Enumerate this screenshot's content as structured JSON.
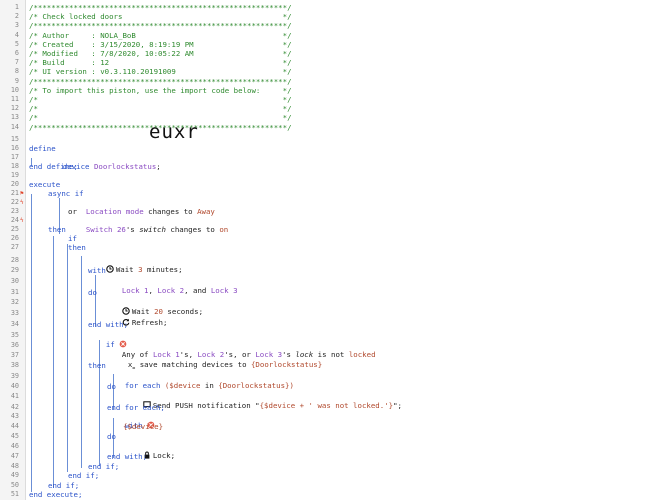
{
  "lines": [
    {
      "n": "1",
      "t": "/*********************************************************/"
    },
    {
      "n": "2",
      "t": "/* Check locked doors                                    */"
    },
    {
      "n": "3",
      "t": "/*********************************************************/"
    },
    {
      "n": "4",
      "t": "/* Author     : NOLA_BoB                                 */"
    },
    {
      "n": "5",
      "t": "/* Created    : 3/15/2020, 8:19:19 PM                    */"
    },
    {
      "n": "6",
      "t": "/* Modified   : 7/8/2020, 10:05:22 AM                    */"
    },
    {
      "n": "7",
      "t": "/* Build      : 12                                       */"
    },
    {
      "n": "8",
      "t": "/* UI version : v0.3.110.20191009                        */"
    },
    {
      "n": "9",
      "t": "/*********************************************************/"
    },
    {
      "n": "10",
      "t": "/* To import this piston, use the import code below:     */"
    },
    {
      "n": "11",
      "t": "/*                                                       */"
    },
    {
      "n": "12",
      "t": "/*                                                       */"
    },
    {
      "n": "13",
      "t": "/*                                                       */"
    },
    {
      "n": "14",
      "t": "/*********************************************************/"
    }
  ],
  "import_code": "euxr",
  "code": {
    "define": "define",
    "device_kw": "device",
    "device_name": "Doorlockstatus",
    "device_semi": ";",
    "end_define": "end define;",
    "execute": "execute",
    "async_if": "async if",
    "l22_a": "Location mode",
    "l22_b": " changes to ",
    "l22_c": "Away",
    "l23": "or",
    "l24_a": "Switch 26",
    "l24_b": "'s ",
    "l24_c": "switch",
    "l24_d": " changes to ",
    "l24_e": "on",
    "then": "then",
    "if": "if",
    "wait_a": "Wait ",
    "wait_b": "3",
    "wait_c": " minutes;",
    "with": "with",
    "locks_a": "Lock 1",
    "locks_b": ", ",
    "locks_c": "Lock 2",
    "locks_d": ", and ",
    "locks_e": "Lock 3",
    "do": "do",
    "wait2_a": "Wait ",
    "wait2_b": "20",
    "wait2_c": " seconds;",
    "refresh": "Refresh;",
    "end_with": "end with;",
    "any_a": "Any of ",
    "any_b": "Lock 1",
    "any_c": "'s, ",
    "any_d": "Lock 2",
    "any_e": "'s, or ",
    "any_f": "Lock 3",
    "any_g": "'s ",
    "any_h": "lock",
    "any_i": " is not ",
    "any_j": "locked",
    "save_a": "save matching devices to ",
    "save_b": "{Doorlockstatus}",
    "foreach_a": "for each ",
    "foreach_b": "($device",
    "foreach_c": " in ",
    "foreach_d": "{Doorlockstatus})",
    "push_a": "Send PUSH notification \"",
    "push_b": "{$device + ' was not locked.'}",
    "push_c": "\";",
    "end_foreach": "end for each;",
    "with_dev": "{$device}",
    "lock": "Lock;",
    "end_if": "end if;",
    "end_execute": "end execute;"
  },
  "line_numbers": [
    "15",
    "16",
    "17",
    "18",
    "19",
    "20",
    "21",
    "22",
    "23",
    "24",
    "25",
    "26",
    "27",
    "28",
    "29",
    "30",
    "31",
    "32",
    "33",
    "34",
    "35",
    "36",
    "37",
    "38",
    "39",
    "40",
    "41",
    "42",
    "43",
    "44",
    "45",
    "46",
    "47",
    "48",
    "49",
    "50",
    "51"
  ],
  "icons": [
    "clock-icon",
    "refresh-icon",
    "message-icon",
    "lock-icon",
    "warning-circle-icon",
    "variable-icon",
    "trigger-icon"
  ]
}
